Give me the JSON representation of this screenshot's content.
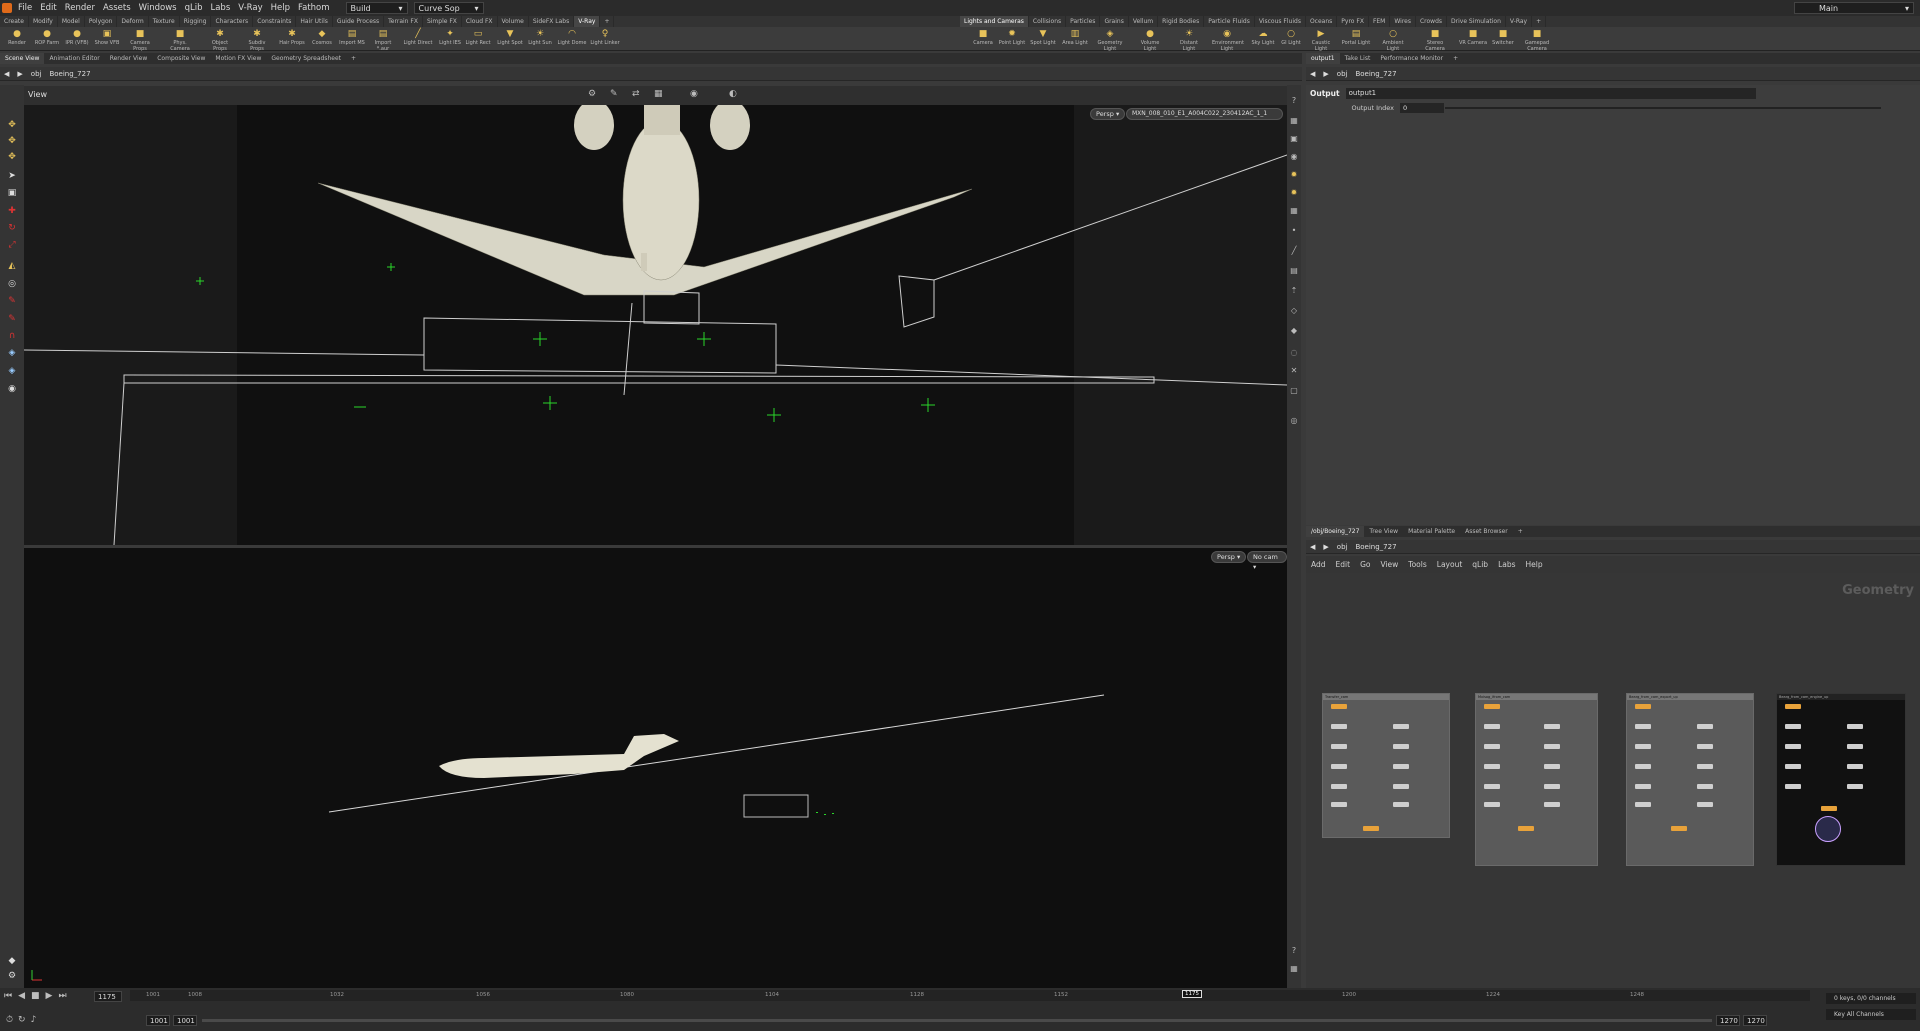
{
  "menubar": {
    "items": [
      "File",
      "Edit",
      "Render",
      "Assets",
      "Windows",
      "qLib",
      "Labs",
      "V-Ray",
      "Help",
      "Fathom"
    ],
    "desktop": "Build",
    "context": "Curve Sop",
    "workspace": "Main"
  },
  "shelf_tabs_left": [
    "Create",
    "Modify",
    "Model",
    "Polygon",
    "Deform",
    "Texture",
    "Rigging",
    "Characters",
    "Constraints",
    "Hair Utils",
    "Guide Process",
    "Terrain FX",
    "Simple FX",
    "Cloud FX",
    "Volume",
    "SideFX Labs",
    "V-Ray"
  ],
  "shelf_tabs_right": [
    "Lights and Cameras",
    "Collisions",
    "Particles",
    "Grains",
    "Vellum",
    "Rigid Bodies",
    "Particle Fluids",
    "Viscous Fluids",
    "Oceans",
    "Pyro FX",
    "FEM",
    "Wires",
    "Crowds",
    "Drive Simulation",
    "V-Ray"
  ],
  "shelf_tools_left": [
    "Render",
    "ROP Farm",
    "IPR (VFB)",
    "Show VFB",
    "Camera Props",
    "Phys. Camera",
    "Object Props",
    "Subdiv Props",
    "Hair Props",
    "Cosmos",
    "Import MS",
    "Import *.aur",
    "Light Direct",
    "Light IES",
    "Light Rect",
    "Light Spot",
    "Light Sun",
    "Light Dome",
    "Light Linker"
  ],
  "shelf_tools_right": [
    "Camera",
    "Point Light",
    "Spot Light",
    "Area Light",
    "Geometry Light",
    "Volume Light",
    "Distant Light",
    "Environment Light",
    "Sky Light",
    "GI Light",
    "Caustic Light",
    "Portal Light",
    "Ambient Light",
    "Stereo Camera",
    "VR Camera",
    "Switcher",
    "Gamepad Camera"
  ],
  "left_pane_tabs": [
    "Scene View",
    "Animation Editor",
    "Render View",
    "Composite View",
    "Motion FX View",
    "Geometry Spreadsheet"
  ],
  "right_top_tabs": [
    "output1",
    "Take List",
    "Performance Monitor"
  ],
  "right_bottom_tabs": [
    "/obj/Boeing_727",
    "Tree View",
    "Material Palette",
    "Asset Browser"
  ],
  "path": {
    "root": "obj",
    "node": "Boeing_727"
  },
  "viewport": {
    "label": "View",
    "top_persp": "Persp",
    "top_camera": "MXN_008_010_E1_A004C022_230412AC_1_1",
    "bottom_persp": "Persp",
    "bottom_camera": "No cam"
  },
  "params": {
    "type": "Output",
    "name": "output1",
    "index_label": "Output Index",
    "index_value": "0"
  },
  "network": {
    "menu": [
      "Add",
      "Edit",
      "Go",
      "View",
      "Tools",
      "Layout",
      "qLib",
      "Labs",
      "Help"
    ],
    "context_label": "Geometry",
    "boxes": [
      "Transfer_cam",
      "Mxisog_ifrom_cam",
      "Bearg_from_cam_export_up",
      "Bearg_from_cam_engine_up"
    ]
  },
  "timeline": {
    "ticks": [
      "1001",
      "1008",
      "1032",
      "1056",
      "1080",
      "1104",
      "1128",
      "1152",
      "1175",
      "1200",
      "1224",
      "1248"
    ],
    "current_frame": "1175",
    "range_start": "1001",
    "range_start2": "1001",
    "range_end": "1270",
    "range_end2": "1270",
    "keys_info": "0 keys, 0/0 channels",
    "key_all": "Key All Channels"
  }
}
